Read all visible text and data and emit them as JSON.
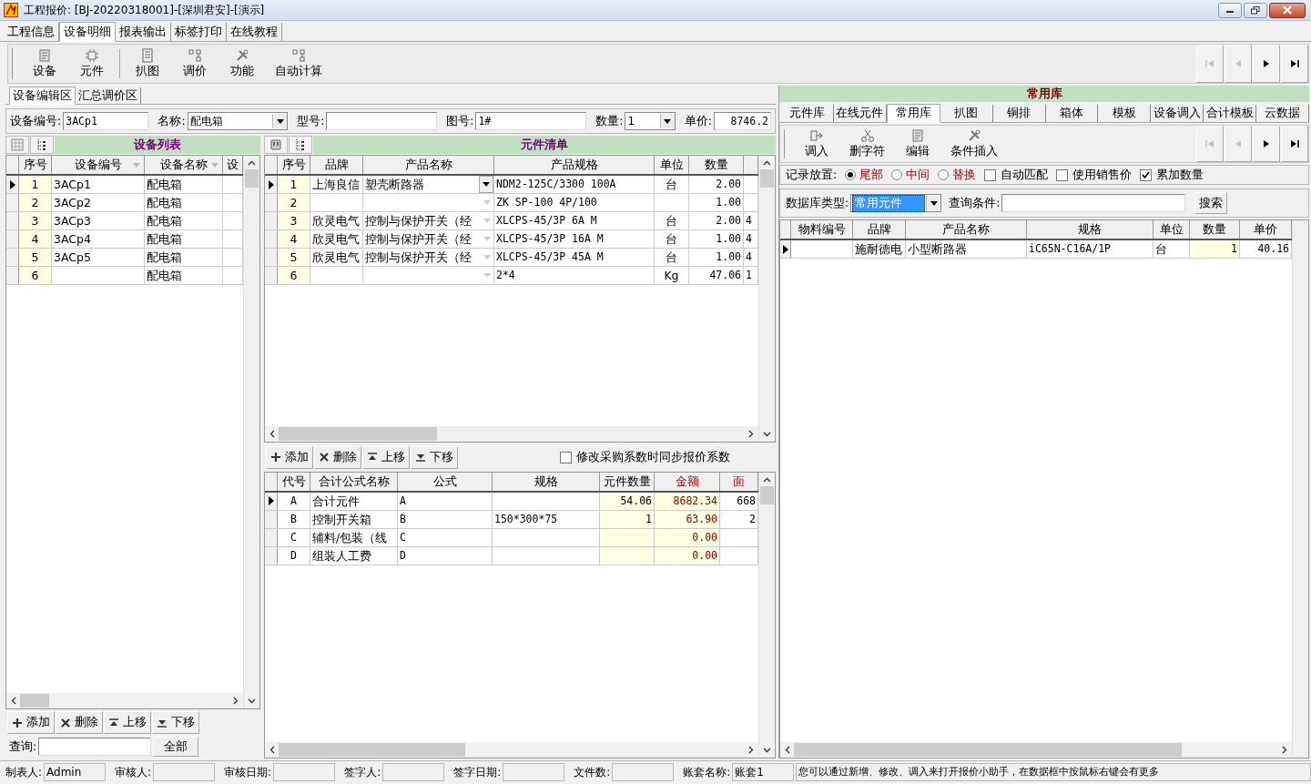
{
  "window": {
    "title": "工程报价: [BJ-20220318001]-[深圳君安]-[演示]"
  },
  "tabs": [
    {
      "label": "工程信息",
      "selected": false
    },
    {
      "label": "设备明细",
      "selected": true
    },
    {
      "label": "报表输出",
      "selected": false
    },
    {
      "label": "标签打印",
      "selected": false
    },
    {
      "label": "在线教程",
      "selected": false
    }
  ],
  "toolbar": [
    {
      "label": "设备",
      "kind": "device"
    },
    {
      "label": "元件",
      "kind": "component"
    },
    {
      "label": "扒图",
      "kind": "capture"
    },
    {
      "label": "调价",
      "kind": "adjust"
    },
    {
      "label": "功能",
      "kind": "function"
    },
    {
      "label": "自动计算",
      "kind": "calc"
    }
  ],
  "nav": [
    {
      "kind": "first",
      "disabled": true
    },
    {
      "kind": "prev",
      "disabled": true
    },
    {
      "kind": "next",
      "disabled": false
    },
    {
      "kind": "last",
      "disabled": false
    }
  ],
  "sub_tabs": [
    {
      "label": "设备编辑区",
      "selected": true
    },
    {
      "label": "汇总调价区",
      "selected": false
    }
  ],
  "device_form": [
    {
      "kind": "text",
      "label": "设备编号:",
      "value": "3ACp1"
    },
    {
      "kind": "dropdown",
      "label": "名称:",
      "value": "配电箱"
    },
    {
      "kind": "text",
      "label": "型号:"
    },
    {
      "kind": "text",
      "label": "图号:",
      "value": "1#"
    },
    {
      "kind": "dropdown",
      "label": "数量:",
      "value": "1"
    },
    {
      "kind": "number",
      "label": "单价:",
      "value": "8746.2"
    }
  ],
  "device_list": {
    "title": "设备列表",
    "columns": [
      "序号",
      "设备编号",
      "设备名称",
      "设"
    ],
    "rows": [
      {
        "no": "1",
        "code": "3ACp1",
        "name": "配电箱",
        "selected": true
      },
      {
        "no": "2",
        "code": "3ACp2",
        "name": "配电箱",
        "selected": false
      },
      {
        "no": "3",
        "code": "3ACp3",
        "name": "配电箱",
        "selected": false
      },
      {
        "no": "4",
        "code": "3ACp4",
        "name": "配电箱",
        "selected": false
      },
      {
        "no": "5",
        "code": "3ACp5",
        "name": "配电箱",
        "selected": false
      },
      {
        "no": "6",
        "name": "配电箱",
        "selected": false
      }
    ]
  },
  "device_buttons": [
    {
      "label": "添加",
      "kind": "add"
    },
    {
      "label": "删除",
      "kind": "delete"
    },
    {
      "label": "上移",
      "kind": "up"
    },
    {
      "label": "下移",
      "kind": "down"
    }
  ],
  "device_query": {
    "label": "查询:",
    "button": "全部"
  },
  "component_list": {
    "title": "元件清单",
    "columns": [
      "序号",
      "品牌",
      "产品名称",
      "产品规格",
      "单位",
      "数量"
    ],
    "rows": [
      {
        "no": "1",
        "brand": "上海良信",
        "product": "塑壳断路器",
        "spec": "NDM2-125C/3300 100A",
        "unit": "台",
        "qty": "2.00",
        "selected": true
      },
      {
        "no": "2",
        "spec": "ZK SP-100 4P/100",
        "qty": "1.00",
        "selected": false
      },
      {
        "no": "3",
        "brand": "欣灵电气",
        "product": "控制与保护开关（经",
        "spec": "XLCPS-45/3P 6A M",
        "unit": "台",
        "qty": "2.00",
        "column_7": "4",
        "selected": false
      },
      {
        "no": "4",
        "brand": "欣灵电气",
        "product": "控制与保护开关（经",
        "spec": "XLCPS-45/3P 16A M",
        "unit": "台",
        "qty": "1.00",
        "column_7": "4",
        "selected": false
      },
      {
        "no": "5",
        "brand": "欣灵电气",
        "product": "控制与保护开关（经",
        "spec": "XLCPS-45/3P 45A M",
        "unit": "台",
        "qty": "1.00",
        "column_7": "4",
        "selected": false
      },
      {
        "no": "6",
        "spec": "2*4",
        "unit": "Kg",
        "qty": "47.06",
        "column_7": "1",
        "selected": false
      }
    ]
  },
  "formula_buttons": [
    {
      "label": "添加",
      "kind": "add"
    },
    {
      "label": "删除",
      "kind": "delete"
    },
    {
      "label": "上移",
      "kind": "up"
    },
    {
      "label": "下移",
      "kind": "down"
    }
  ],
  "sync_option": {
    "label": "修改采购系数时同步报价系数",
    "checked": false
  },
  "formula_table": {
    "columns": [
      "代号",
      "合计公式名称",
      "公式",
      "规格",
      "元件数量",
      "金额",
      "面"
    ],
    "rows": [
      {
        "code": "A",
        "name": "合计元件",
        "formula": "A",
        "qty": "54.06",
        "amount": "8682.34",
        "column_7": "668",
        "selected": true
      },
      {
        "code": "B",
        "name": "控制开关箱",
        "formula": "B",
        "spec": "150*300*75",
        "qty": "1",
        "amount": "63.90",
        "column_7": "2",
        "selected": false
      },
      {
        "code": "C",
        "name": "辅料/包装（线",
        "formula": "C",
        "amount": "0.00",
        "selected": false
      },
      {
        "code": "D",
        "name": "组装人工费",
        "formula": "D",
        "amount": "0.00",
        "selected": false
      }
    ]
  },
  "library": {
    "title": "常用库",
    "tabs": [
      {
        "label": "元件库",
        "selected": false
      },
      {
        "label": "在线元件",
        "selected": false
      },
      {
        "label": "常用库",
        "selected": true
      },
      {
        "label": "扒图",
        "selected": false
      },
      {
        "label": "铜排",
        "selected": false
      },
      {
        "label": "箱体",
        "selected": false
      },
      {
        "label": "模板",
        "selected": false
      },
      {
        "label": "设备调入",
        "selected": false
      },
      {
        "label": "合计模板",
        "selected": false
      },
      {
        "label": "云数据",
        "selected": false
      }
    ],
    "toolbar": [
      {
        "label": "调入",
        "kind": "import"
      },
      {
        "label": "删字符",
        "kind": "cut"
      },
      {
        "label": "编辑",
        "kind": "edit"
      },
      {
        "label": "条件插入",
        "kind": "insert"
      }
    ],
    "nav": [
      {
        "kind": "first",
        "disabled": true
      },
      {
        "kind": "prev",
        "disabled": true
      },
      {
        "kind": "next",
        "disabled": false
      },
      {
        "kind": "last",
        "disabled": false
      }
    ],
    "placement_label": "记录放置:",
    "placements": [
      {
        "label": "尾部",
        "selected": true
      },
      {
        "label": "中间",
        "selected": false
      },
      {
        "label": "替换",
        "selected": false
      }
    ],
    "options": [
      {
        "label": "自动匹配",
        "checked": false
      },
      {
        "label": "使用销售价",
        "checked": false
      },
      {
        "label": "累加数量",
        "checked": true
      }
    ],
    "db_type": {
      "label": "数据库类型:",
      "value": "常用元件"
    },
    "query": {
      "label": "查询条件:"
    },
    "search_button": "搜索",
    "columns": [
      "物料编号",
      "品牌",
      "产品名称",
      "规格",
      "单位",
      "数量",
      "单价"
    ],
    "rows": [
      {
        "brand": "施耐德电",
        "product": "小型断路器",
        "spec": "iC65N-C16A/1P",
        "unit": "台",
        "qty": "1",
        "price": "40.16",
        "selected": true
      }
    ]
  },
  "status_bar": {
    "fields": [
      {
        "label": "制表人:",
        "value": "Admin"
      },
      {
        "label": "审核人:"
      },
      {
        "label": "审核日期:"
      },
      {
        "label": "签字人:"
      },
      {
        "label": "签字日期:"
      },
      {
        "label": "文件数:"
      },
      {
        "label": "账套名称:",
        "value": "账套1"
      }
    ],
    "message": "您可以通过新增、修改、调入来打开报价小助手，在数据框中按鼠标右键会有更多"
  }
}
